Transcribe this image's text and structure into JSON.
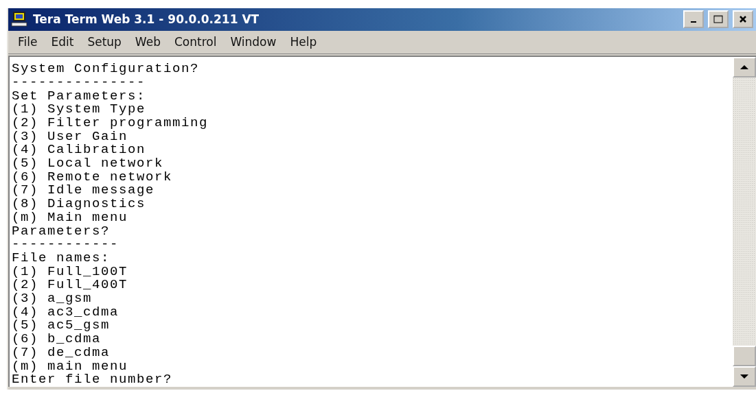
{
  "window": {
    "title": "Tera Term Web 3.1 - 90.0.0.211 VT"
  },
  "menu": [
    "File",
    "Edit",
    "Setup",
    "Web",
    "Control",
    "Window",
    "Help"
  ],
  "terminal": {
    "lines": [
      "System Configuration?",
      "---------------",
      "Set Parameters:",
      "(1) System Type",
      "(2) Filter programming",
      "(3) User Gain",
      "(4) Calibration",
      "(5) Local network",
      "(6) Remote network",
      "(7) Idle message",
      "(8) Diagnostics",
      "(m) Main menu",
      "Parameters?",
      "------------",
      "File names:",
      "(1) Full_100T",
      "(2) Full_400T",
      "(3) a_gsm",
      "(4) ac3_cdma",
      "(5) ac5_gsm",
      "(6) b_cdma",
      "(7) de_cdma",
      "(m) main menu",
      "Enter file number?"
    ]
  }
}
